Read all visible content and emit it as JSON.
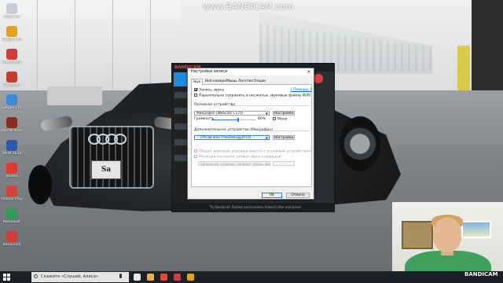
{
  "watermark": "www.BANDICAM.com",
  "desktop_icons": [
    {
      "label": "Корзина",
      "icon": "recycle-bin-icon",
      "color": "#c7ccd3"
    },
    {
      "label": "Google Chrome",
      "icon": "chrome-icon",
      "color": "#e2a41f"
    },
    {
      "label": "Bandicam",
      "icon": "bandicam-icon",
      "color": "#d43c3c"
    },
    {
      "label": "CCleaner",
      "icon": "ccleaner-icon",
      "color": "#c93a2e"
    },
    {
      "label": "Google Chrome",
      "icon": "chrome-icon",
      "color": "#3d8ad6"
    },
    {
      "label": "Mortal Kombat",
      "icon": "game-icon",
      "color": "#8c2d1d"
    },
    {
      "label": "Word 2016",
      "icon": "word-icon",
      "color": "#2b5aa8"
    },
    {
      "label": "Yandex",
      "icon": "yandex-icon",
      "color": "#e03a2f"
    },
    {
      "label": "Roblox Player",
      "icon": "roblox-icon",
      "color": "#d9413b"
    },
    {
      "label": "MediaGet",
      "icon": "mediaget-icon",
      "color": "#2f9c58"
    },
    {
      "label": "Bandicam",
      "icon": "bandicam-icon",
      "color": "#d43c3c"
    }
  ],
  "app": {
    "logo": "BANDICAM",
    "footer": "Try Bandicut! Fastest and Lossless Video Cutter and Joiner"
  },
  "dialog": {
    "title": "Настройки записи",
    "close": "✕",
    "tabs": [
      "Звук",
      "Веб-камера",
      "Мышь",
      "Логотип",
      "Опции"
    ],
    "active_tab": "Звук",
    "record_audio_label": "Запись звука",
    "record_audio_checked": true,
    "help_link": "[ Помощь ]",
    "save_wav_label": "Параллельно сохранять в несжатые звуковые файлы WAV",
    "save_wav_checked": false,
    "main_device_title": "Основное устройство",
    "main_device_value": "Микрофон (Webcam C170)",
    "settings_button": "Настройки",
    "volume_label": "Громкость",
    "volume_value": "60%",
    "volume_fraction": 0.6,
    "mono_label": "Моно",
    "mono_checked": false,
    "extra_device_title": "Дополнительное устройство (Микрофон)",
    "extra_device_value": "-- Отключено (Рекомендуется) --",
    "settings_button_2": "Настройки",
    "mix_tracks_label": "Общая звуковая дорожка вместе с основным устройством",
    "hotkey_label": "Функция контроля записи звука клавишей",
    "hotkey_field": "Удержание клавиши (запишет запись звука)",
    "hotkey_key": "",
    "ok_button": "OK",
    "cancel_button": "Отмена"
  },
  "taskbar": {
    "search_placeholder": "Скажите «Слушай, Алиса»",
    "pinned": [
      {
        "icon": "task-view-icon",
        "color": "#e9e9e9"
      },
      {
        "icon": "file-explorer-icon",
        "color": "#e6b43a"
      },
      {
        "icon": "yandex-browser-icon",
        "color": "#e24a3a"
      },
      {
        "icon": "bandicam-icon",
        "color": "#d43c3c"
      },
      {
        "icon": "chrome-icon",
        "color": "#e2a41f"
      }
    ]
  },
  "webcam_watermark": "BANDICAM"
}
